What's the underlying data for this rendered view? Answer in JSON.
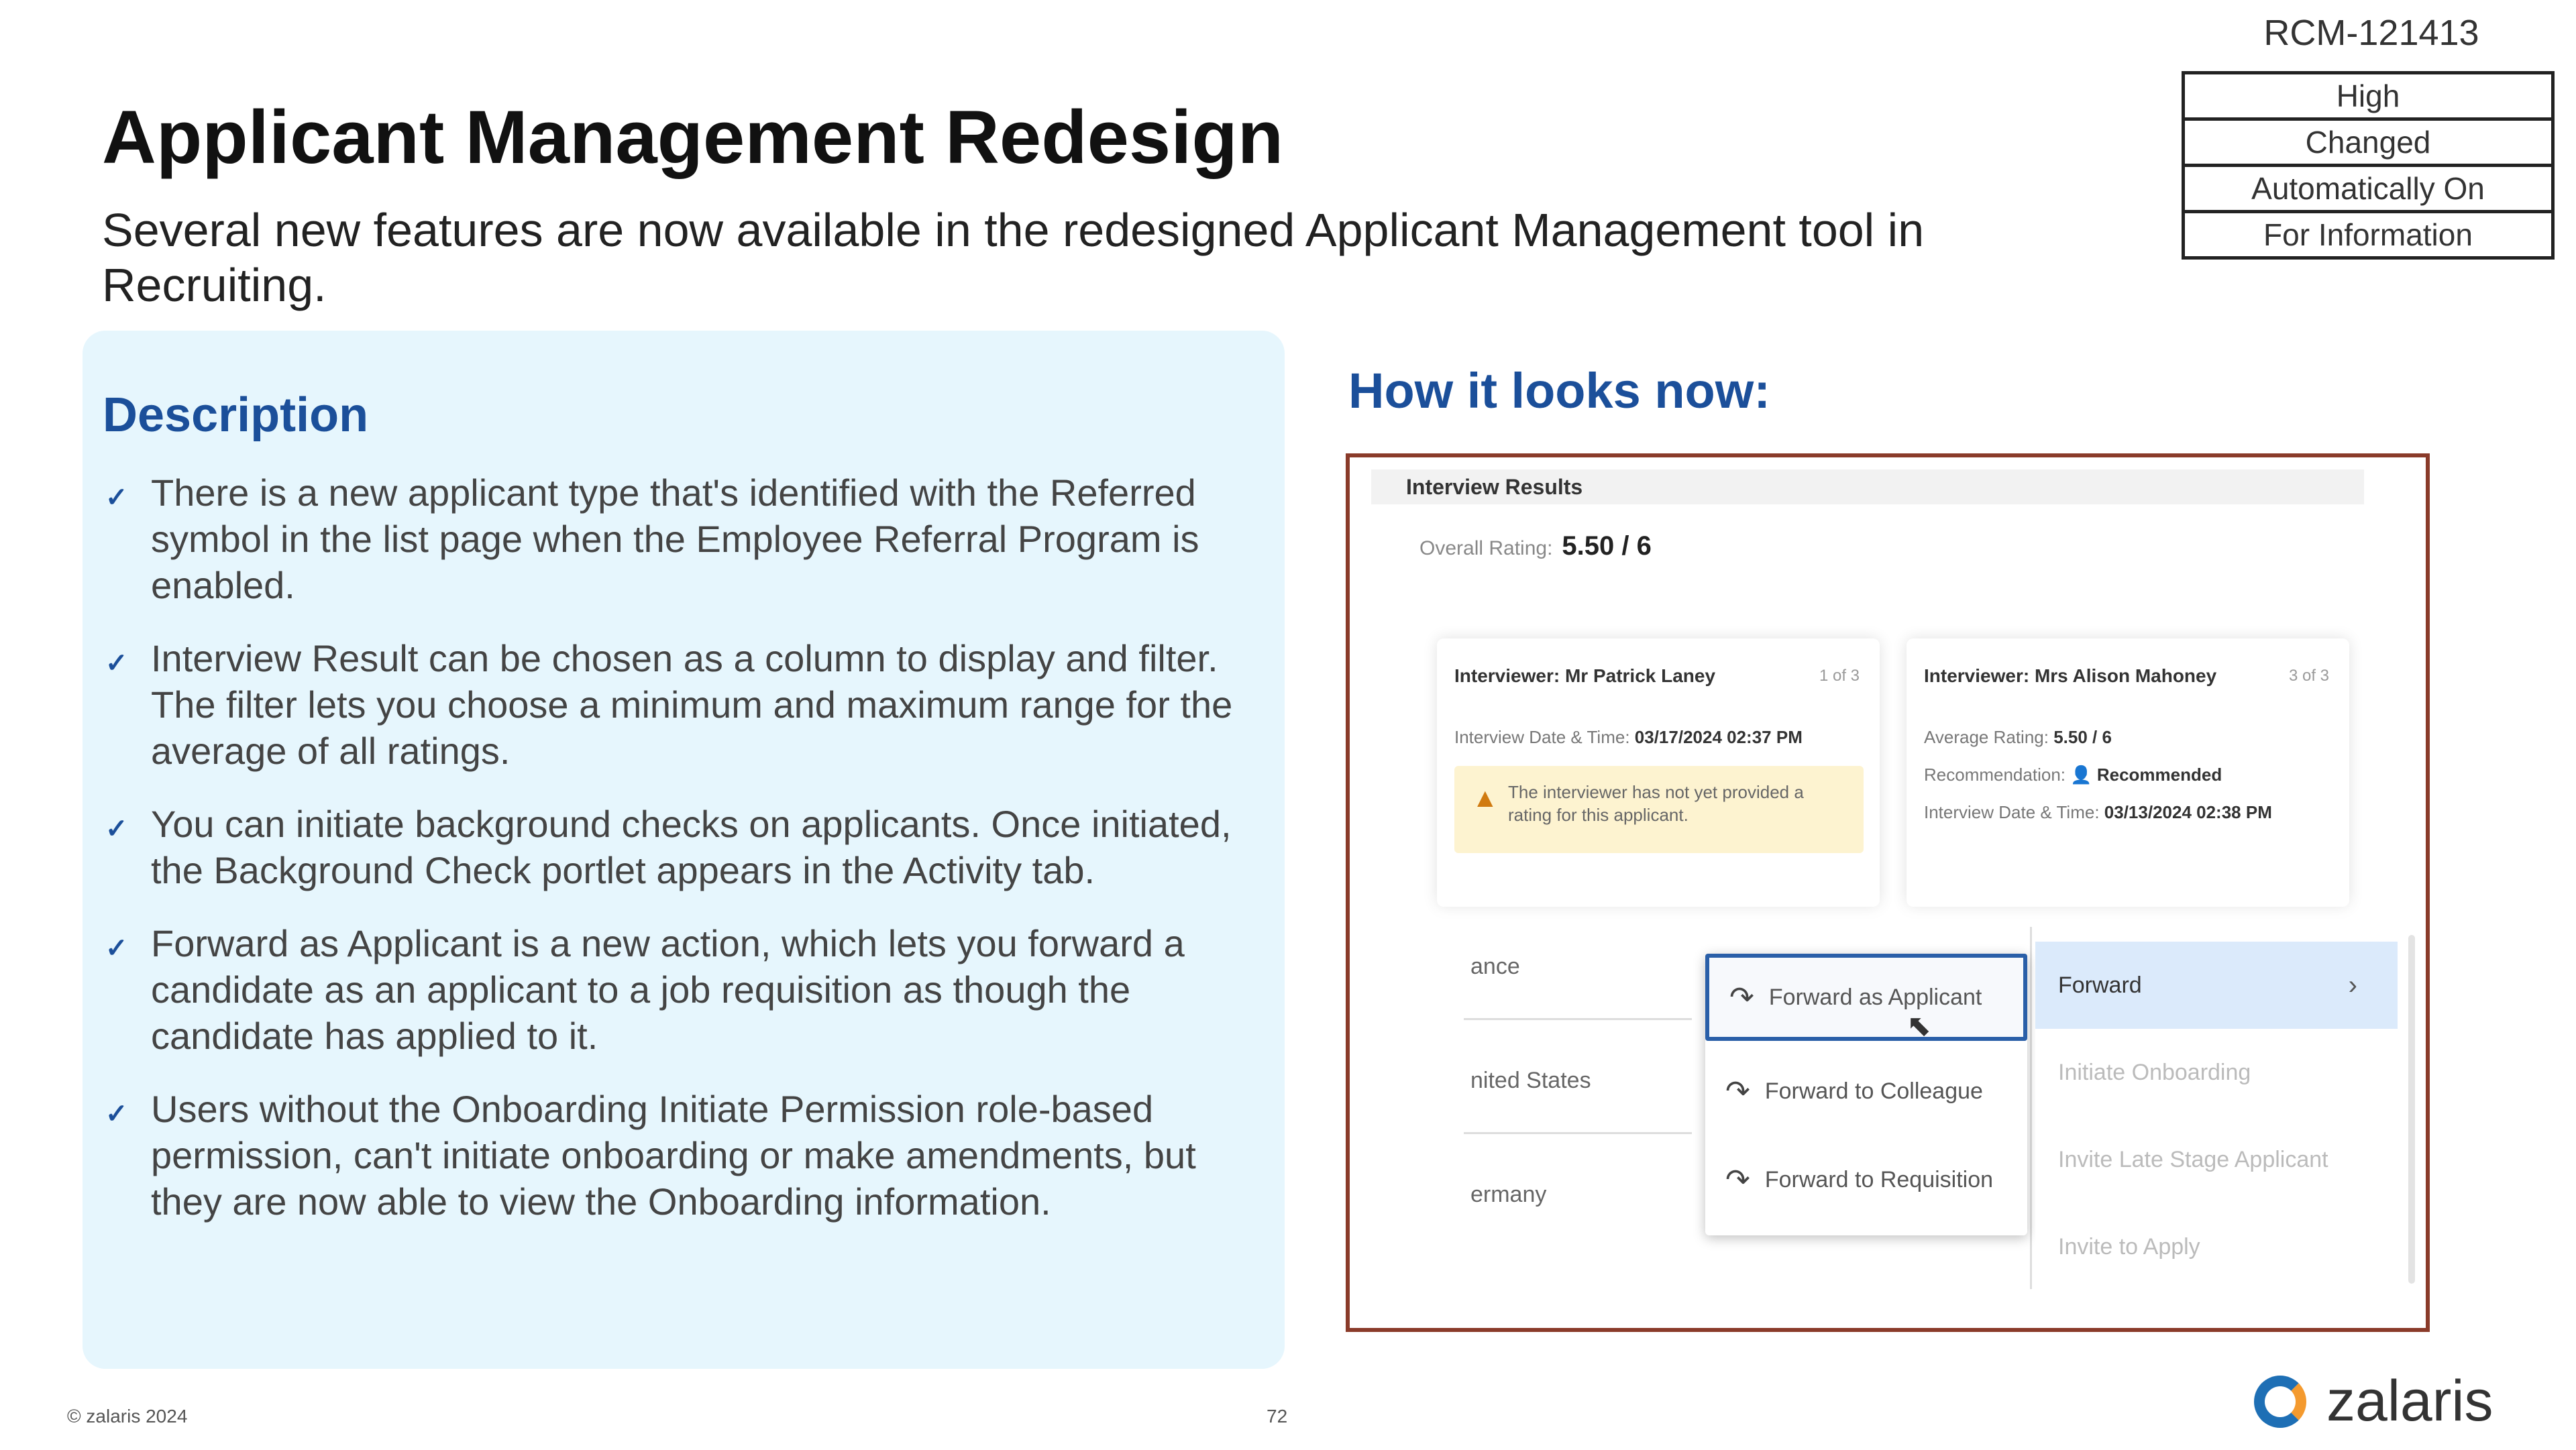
{
  "header": {
    "code": "RCM-121413",
    "tags": [
      "High",
      "Changed",
      "Automatically On",
      "For Information"
    ],
    "title": "Applicant Management Redesign",
    "subtitle": "Several new features are now available in the redesigned Applicant Management tool in Recruiting."
  },
  "description": {
    "title": "Description",
    "bullets": [
      "There is a new applicant type that's identified with the Referred symbol in the list page when the Employee Referral Program is enabled.",
      "Interview Result can be chosen as a column to display and filter. The filter lets you choose a minimum and maximum range for the average of all ratings.",
      "You can initiate background checks on applicants. Once initiated, the Background Check portlet appears in the Activity tab.",
      "Forward as Applicant is a new action, which lets you forward a candidate as an applicant to a job requisition as though the candidate has applied to it.",
      "Users without the Onboarding Initiate Permission role-based permission, can't initiate onboarding or make amendments, but they are now able to view the Onboarding information."
    ]
  },
  "screenshot": {
    "heading": "How it looks now:",
    "section_title": "Interview Results",
    "overall_label": "Overall Rating:",
    "overall_value": "5.50 / 6",
    "card1": {
      "name": "Interviewer: Mr Patrick Laney",
      "count": "1 of 3",
      "date_label": "Interview Date & Time:",
      "date_value": "03/17/2024 02:37 PM",
      "warning": "The interviewer has not yet provided a rating for this applicant."
    },
    "card2": {
      "name": "Interviewer: Mrs Alison Mahoney",
      "count": "3 of 3",
      "avg_label": "Average Rating:",
      "avg_value": "5.50 / 6",
      "rec_label": "Recommendation:",
      "rec_value": "Recommended",
      "date_label": "Interview Date & Time:",
      "date_value": "03/13/2024 02:38 PM"
    },
    "row_labels": [
      "ance",
      "nited States",
      "ermany"
    ],
    "menu_left": [
      "Forward as Applicant",
      "Forward to Colleague",
      "Forward to Requisition"
    ],
    "menu_right": [
      "Forward",
      "Initiate Onboarding",
      "Invite Late Stage Applicant",
      "Invite to Apply"
    ]
  },
  "footer": {
    "copyright": "© zalaris 2024",
    "page_number": "72",
    "brand": "zalaris"
  },
  "colors": {
    "accent_blue": "#1b4f9a",
    "panel_bg": "#e6f6fd",
    "screenshot_border": "#8a3b2a",
    "logo_blue": "#1e6fb5",
    "logo_orange": "#f49a2e"
  }
}
